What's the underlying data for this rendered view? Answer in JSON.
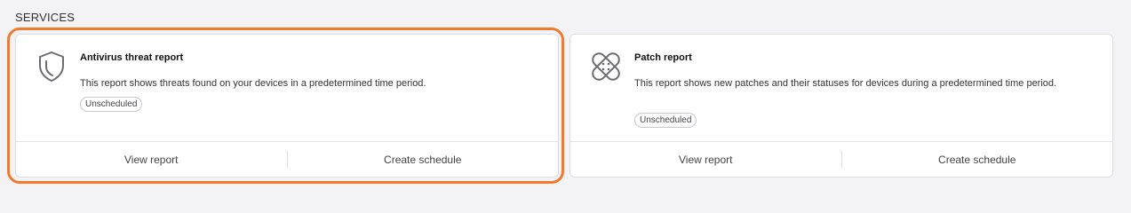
{
  "section": {
    "title": "SERVICES"
  },
  "cards": [
    {
      "title": "Antivirus threat report",
      "description": "This report shows threats found on your devices in a predetermined time period.",
      "status": "Unscheduled",
      "icon": "shield-icon",
      "view_label": "View report",
      "schedule_label": "Create schedule"
    },
    {
      "title": "Patch report",
      "description": "This report shows new patches and their statuses for devices during a predetermined time period.",
      "status": "Unscheduled",
      "icon": "bandage-icon",
      "view_label": "View report",
      "schedule_label": "Create schedule"
    }
  ],
  "colors": {
    "highlight": "#f37a2c",
    "card_bg": "#ffffff",
    "page_bg": "#f3f3f6"
  }
}
